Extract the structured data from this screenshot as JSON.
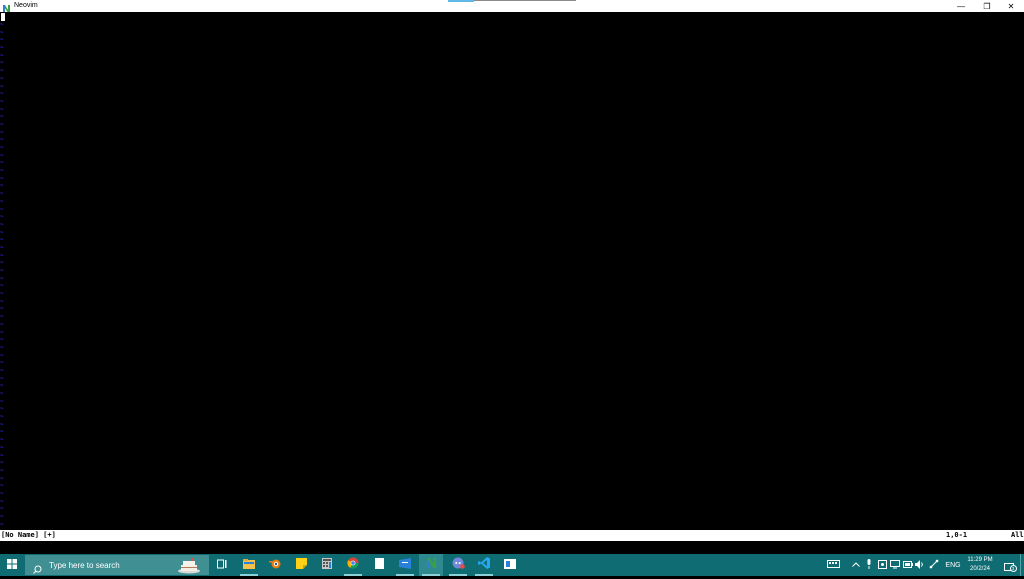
{
  "window": {
    "title": "Neovim",
    "minimize_glyph": "—",
    "restore_glyph": "❐",
    "close_glyph": "✕"
  },
  "editor": {
    "empty_line_marker": "~",
    "empty_line_count": 66
  },
  "statusline": {
    "buffer": "[No Name] [+]",
    "position": "1,0-1",
    "percent": "All"
  },
  "taskbar": {
    "search_placeholder": "Type here to search",
    "apps": [
      {
        "name": "task-view-icon"
      },
      {
        "name": "file-explorer-icon"
      },
      {
        "name": "blender-icon"
      },
      {
        "name": "sticky-notes-icon"
      },
      {
        "name": "calculator-icon"
      },
      {
        "name": "chrome-icon"
      },
      {
        "name": "notepad-icon"
      },
      {
        "name": "store-icon"
      },
      {
        "name": "neovim-icon",
        "active": true
      },
      {
        "name": "discord-icon"
      },
      {
        "name": "vscode-icon"
      },
      {
        "name": "app-window-icon"
      }
    ],
    "tray": {
      "language": "ENG",
      "time": "11:29 PM",
      "date": "20/2/24",
      "notification_count": "3"
    }
  },
  "colors": {
    "taskbar": "#0f6c73",
    "tilde": "#3030ff",
    "neovim_green": "#3aa043"
  }
}
